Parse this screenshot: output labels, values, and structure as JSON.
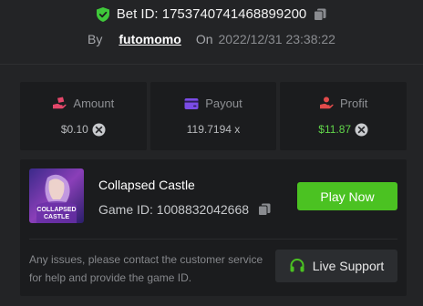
{
  "bet": {
    "id_label": "Bet ID: 1753740741468899200",
    "by_label": "By",
    "username": "futomomo",
    "on_label": "On",
    "date": "2022/12/31 23:38:22"
  },
  "stats": [
    {
      "label": "Amount",
      "value": "$0.10",
      "icon": "money-hand-icon",
      "icon_color": "#e4476a"
    },
    {
      "label": "Payout",
      "value": "119.7194 x",
      "icon": "wallet-icon",
      "icon_color": "#7b4ce6"
    },
    {
      "label": "Profit",
      "value": "$11.87",
      "icon": "profit-hand-icon",
      "icon_color": "#e24b4b"
    }
  ],
  "game": {
    "name": "Collapsed Castle",
    "id_label": "Game ID: 1008832042668",
    "thumb_text_line1": "COLLAPSED",
    "thumb_text_line2": "CASTLE",
    "play_label": "Play Now"
  },
  "support": {
    "help_text": "Any issues, please contact the customer service for help and provide the game ID.",
    "button_label": "Live Support"
  },
  "colors": {
    "background": "#232426",
    "panel": "#1b1c1e",
    "accent_green": "#4bc222",
    "profit_green": "#61d54a",
    "shield_green": "#3fc83a"
  }
}
